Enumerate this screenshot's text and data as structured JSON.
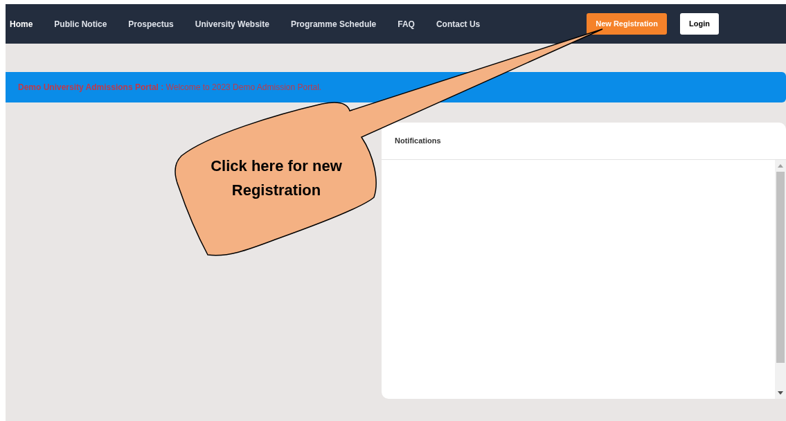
{
  "nav": {
    "links": [
      {
        "label": "Home",
        "selected": true
      },
      {
        "label": "Public Notice",
        "selected": false
      },
      {
        "label": "Prospectus",
        "selected": false
      },
      {
        "label": "University Website",
        "selected": false
      },
      {
        "label": "Programme Schedule",
        "selected": false
      },
      {
        "label": "FAQ",
        "selected": false
      },
      {
        "label": "Contact Us",
        "selected": false
      }
    ],
    "buttons": [
      {
        "label": "New Registration",
        "kind": "primary"
      },
      {
        "label": "Login",
        "kind": "secondary"
      }
    ]
  },
  "banner": {
    "text": "**Demo University Admissions Portal :** Welcome to 2023 Demo Admission Portal."
  },
  "notifications": {
    "title": "Notifications"
  },
  "callout": {
    "text": "Click here for new Registration"
  }
}
